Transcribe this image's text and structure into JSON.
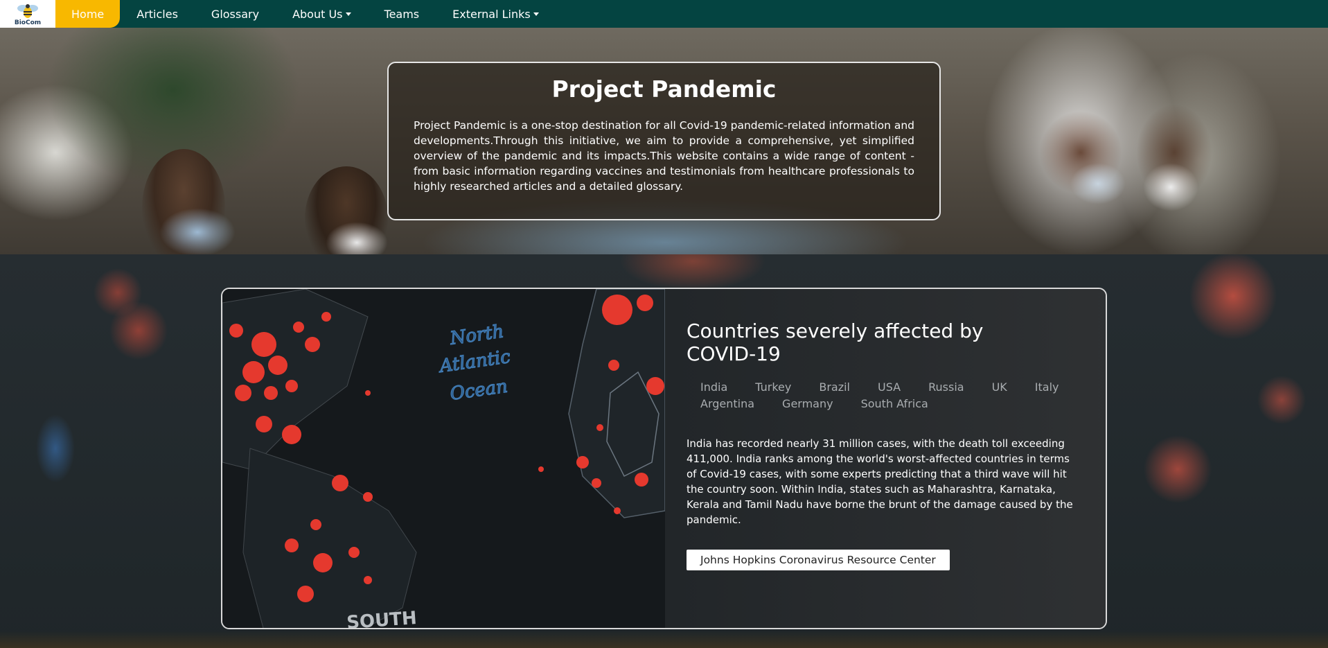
{
  "navbar": {
    "logo_text": "BioCom",
    "items": [
      {
        "label": "Home",
        "active": true,
        "dropdown": false
      },
      {
        "label": "Articles",
        "active": false,
        "dropdown": false
      },
      {
        "label": "Glossary",
        "active": false,
        "dropdown": false
      },
      {
        "label": "About Us",
        "active": false,
        "dropdown": true
      },
      {
        "label": "Teams",
        "active": false,
        "dropdown": false
      },
      {
        "label": "External Links",
        "active": false,
        "dropdown": true
      }
    ]
  },
  "hero": {
    "title": "Project Pandemic",
    "description": "Project Pandemic is a one-stop destination for all Covid-19 pandemic-related information and developments.Through this initiative, we aim to provide a comprehensive, yet simplified overview of the pandemic and its impacts.This website contains a wide range of content - from basic information regarding vaccines and testimonials from healthcare professionals to highly researched articles and a detailed glossary."
  },
  "affected": {
    "title": "Countries severely affected by COVID-19",
    "countries": [
      "India",
      "Turkey",
      "Brazil",
      "USA",
      "Russia",
      "UK",
      "Italy",
      "Argentina",
      "Germany",
      "South Africa"
    ],
    "selected": "India",
    "text": "India has recorded nearly 31 million cases, with the death toll exceeding 411,000. India ranks among the world's worst-affected countries in terms of Covid-19 cases, with some experts predicting that a third wave will hit the country soon. Within India, states such as Maharashtra, Karnataka, Kerala and Tamil Nadu have borne the brunt of the damage caused by the pandemic.",
    "button_label": "Johns Hopkins Coronavirus Resource Center",
    "map_labels": {
      "ocean_line1": "North",
      "ocean_line2": "Atlantic",
      "ocean_line3": "Ocean",
      "south": "SOUTH"
    }
  },
  "colors": {
    "navbar_bg": "#044441",
    "active_tab": "#f8b800",
    "map_dot": "#e5392e",
    "map_label": "#4a8fd1"
  }
}
